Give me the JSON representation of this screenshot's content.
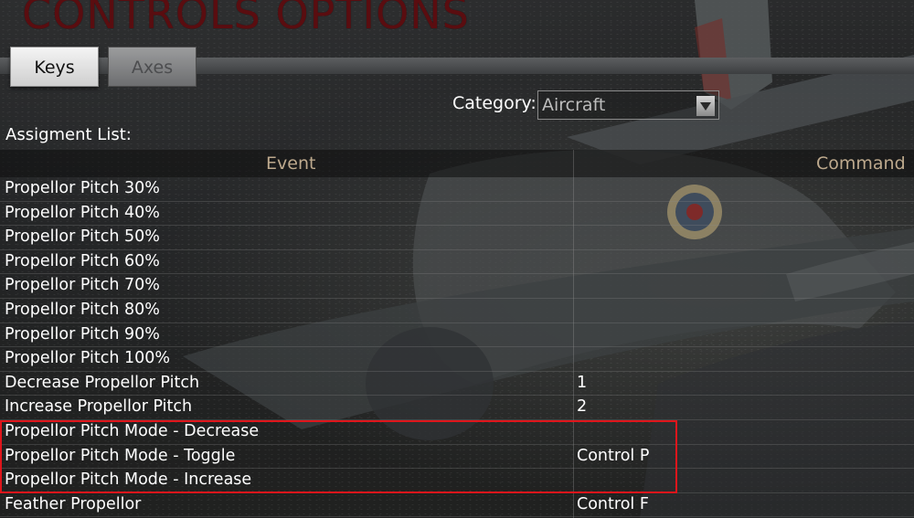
{
  "screen": {
    "title": "CONTROLS OPTIONS",
    "tabs": [
      {
        "label": "Keys",
        "active": true
      },
      {
        "label": "Axes",
        "active": false
      }
    ],
    "category": {
      "label": "Category:",
      "value": "Aircraft"
    },
    "list_title": "Assigment List:",
    "table": {
      "headers": {
        "event": "Event",
        "command": "Command"
      },
      "rows": [
        {
          "event": "Propellor Pitch 30%",
          "command": ""
        },
        {
          "event": "Propellor Pitch 40%",
          "command": ""
        },
        {
          "event": "Propellor Pitch 50%",
          "command": ""
        },
        {
          "event": "Propellor Pitch 60%",
          "command": ""
        },
        {
          "event": "Propellor Pitch 70%",
          "command": ""
        },
        {
          "event": "Propellor Pitch 80%",
          "command": ""
        },
        {
          "event": "Propellor Pitch 90%",
          "command": ""
        },
        {
          "event": "Propellor Pitch 100%",
          "command": ""
        },
        {
          "event": "Decrease Propellor Pitch",
          "command": "1"
        },
        {
          "event": "Increase Propellor Pitch",
          "command": "2"
        },
        {
          "event": "Propellor Pitch Mode - Decrease",
          "command": ""
        },
        {
          "event": "Propellor Pitch Mode - Toggle",
          "command": "Control P"
        },
        {
          "event": "Propellor Pitch Mode - Increase",
          "command": ""
        },
        {
          "event": "Feather Propellor",
          "command": "Control F"
        }
      ]
    }
  },
  "colors": {
    "title": "#5a0d10",
    "header_text": "#bda98d",
    "highlight": "#e0151b"
  }
}
